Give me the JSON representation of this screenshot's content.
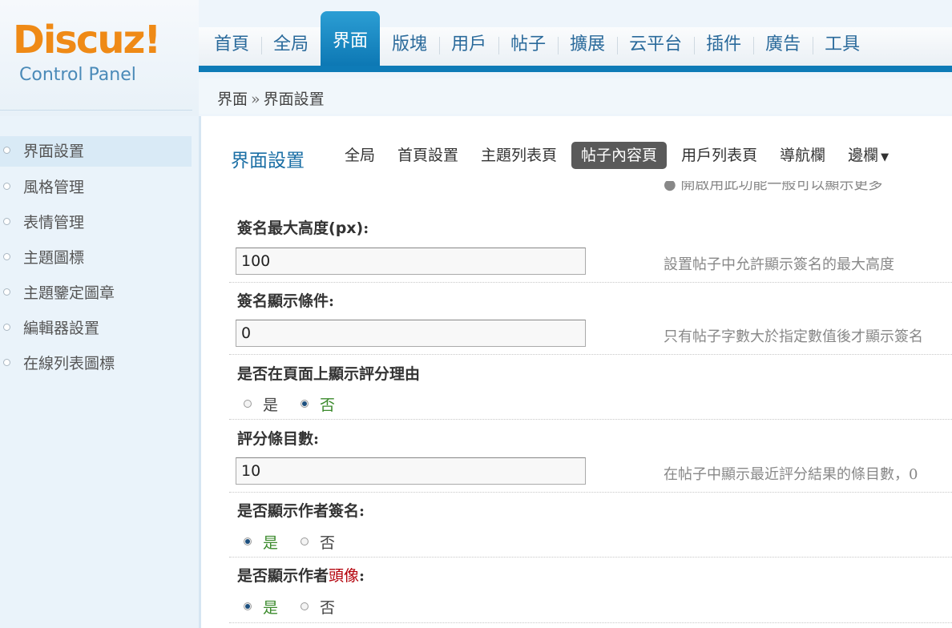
{
  "logo": {
    "word": "Discuz!",
    "subtitle": "Control Panel"
  },
  "nav": [
    {
      "label": "首頁",
      "active": false
    },
    {
      "label": "全局",
      "active": false
    },
    {
      "label": "界面",
      "active": true
    },
    {
      "label": "版塊",
      "active": false
    },
    {
      "label": "用戶",
      "active": false
    },
    {
      "label": "帖子",
      "active": false
    },
    {
      "label": "擴展",
      "active": false
    },
    {
      "label": "云平台",
      "active": false
    },
    {
      "label": "插件",
      "active": false
    },
    {
      "label": "廣告",
      "active": false
    },
    {
      "label": "工具",
      "active": false
    }
  ],
  "breadcrumb": {
    "parent": "界面",
    "separator": "»",
    "current": "界面設置"
  },
  "sidebar": {
    "items": [
      {
        "label": "界面設置",
        "active": true
      },
      {
        "label": "風格管理",
        "active": false
      },
      {
        "label": "表情管理",
        "active": false
      },
      {
        "label": "主題圖標",
        "active": false
      },
      {
        "label": "主題鑒定圖章",
        "active": false
      },
      {
        "label": "編輯器設置",
        "active": false
      },
      {
        "label": "在線列表圖標",
        "active": false
      }
    ]
  },
  "main": {
    "title": "界面設置",
    "subtabs": [
      {
        "label": "全局",
        "active": false
      },
      {
        "label": "首頁設置",
        "active": false
      },
      {
        "label": "主題列表頁",
        "active": false
      },
      {
        "label": "帖子內容頁",
        "active": true
      },
      {
        "label": "用戶列表頁",
        "active": false
      },
      {
        "label": "導航欄",
        "active": false
      },
      {
        "label": "邊欄",
        "active": false,
        "arrow": "▼"
      }
    ],
    "clipped_tip": "● 開啟用此功能一般可以顯示更多",
    "signature_height": {
      "label": "簽名最大高度",
      "label_unit": "(px)",
      "label_suffix": ":",
      "value": "100",
      "tip": "設置帖子中允許顯示簽名的最大高度"
    },
    "signature_condition": {
      "label": "簽名顯示條件:",
      "value": "0",
      "tip": "只有帖子字數大於指定數值後才顯示簽名"
    },
    "show_rate_reason": {
      "label": "是否在頁面上顯示評分理由",
      "options": [
        "是",
        "否"
      ],
      "selected": 1
    },
    "rate_count": {
      "label": "評分條目數:",
      "value": "10",
      "tip": "在帖子中顯示最近評分結果的條目數，0"
    },
    "show_signature": {
      "label": "是否顯示作者簽名:",
      "options": [
        "是",
        "否"
      ],
      "selected": 0
    },
    "show_avatar": {
      "label_a": "是否顯示作者",
      "label_red": "頭像",
      "label_b": ":",
      "options": [
        "是",
        "否"
      ],
      "selected": 0
    }
  },
  "colors": {
    "nav_active": "#0e7bb7",
    "brand_orange": "#ef8a16",
    "title_blue": "#1b6fa5",
    "selected_green": "#3b8a2c",
    "highlight_red": "#b3000a"
  }
}
